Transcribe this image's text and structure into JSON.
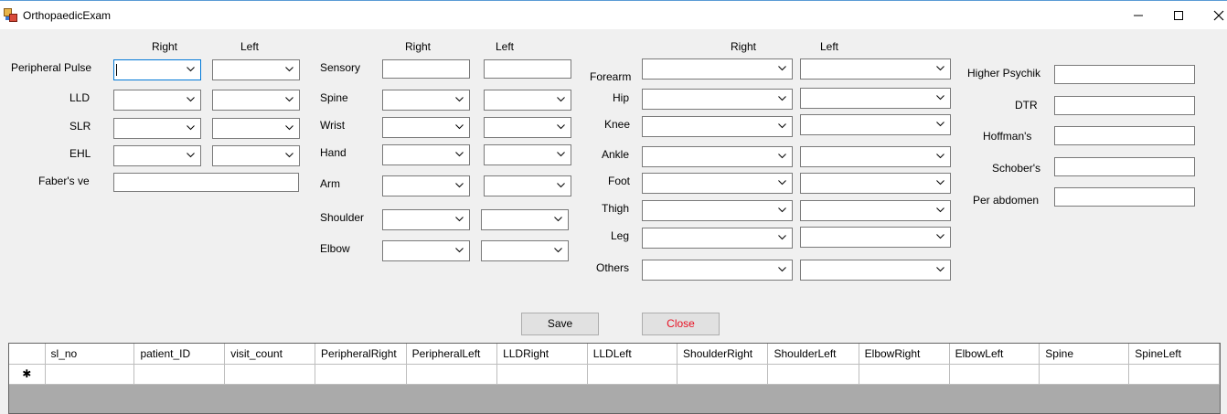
{
  "window": {
    "title": "OrthopaedicExam",
    "minimize_icon": "minimize-icon",
    "maximize_icon": "maximize-icon",
    "close_icon": "close-icon"
  },
  "group1": {
    "right_header": "Right",
    "left_header": "Left",
    "labels": {
      "peripheral_pulse": "Peripheral Pulse",
      "lld": "LLD",
      "slr": "SLR",
      "ehl": "EHL",
      "fabers": "Faber's ve"
    }
  },
  "group2": {
    "right_header": "Right",
    "left_header": "Left",
    "labels": {
      "sensory": "Sensory",
      "spine": "Spine",
      "wrist": "Wrist",
      "hand": "Hand",
      "arm": "Arm",
      "shoulder": "Shoulder",
      "elbow": "Elbow"
    }
  },
  "group3": {
    "right_header": "Right",
    "left_header": "Left",
    "labels": {
      "forearm": "Forearm",
      "hip": "Hip",
      "knee": "Knee",
      "ankle": "Ankle",
      "foot": "Foot",
      "thigh": "Thigh",
      "leg": "Leg",
      "others": "Others"
    }
  },
  "group4": {
    "labels": {
      "higher_psychik": "Higher Psychik",
      "dtr": "DTR",
      "hoffmans": "Hoffman's",
      "schobers": "Schober's",
      "per_abdomen": "Per abdomen"
    }
  },
  "buttons": {
    "save": "Save",
    "close": "Close",
    "close_color": "#e81123"
  },
  "grid": {
    "columns": [
      "sl_no",
      "patient_ID",
      "visit_count",
      "PeripheralRight",
      "PeripheralLeft",
      "LLDRight",
      "LLDLeft",
      "ShoulderRight",
      "ShoulderLeft",
      "ElbowRight",
      "ElbowLeft",
      "Spine",
      "SpineLeft"
    ],
    "new_row_marker": "✱"
  }
}
